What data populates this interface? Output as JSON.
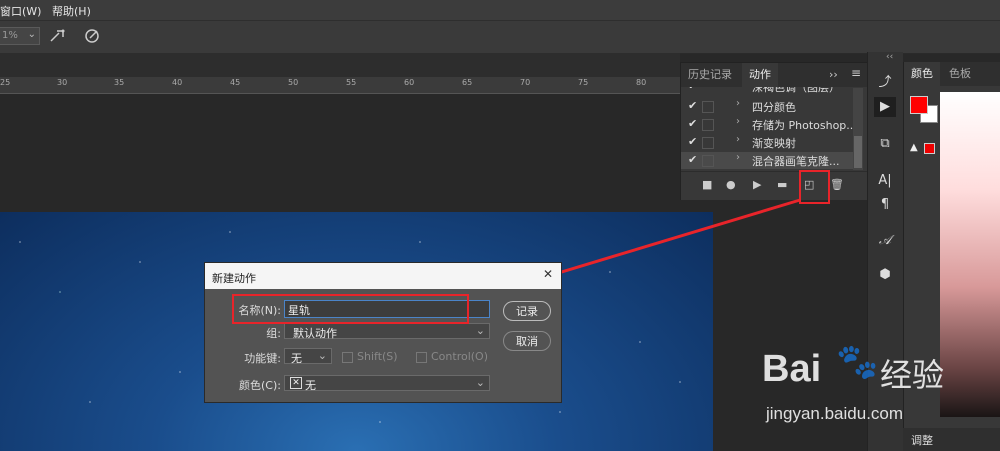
{
  "menu": {
    "window": "窗口(W)",
    "help": "帮助(H)"
  },
  "options": {
    "zoom_value": "1%"
  },
  "ruler": {
    "ticks": [
      "25",
      "30",
      "35",
      "40",
      "45",
      "50",
      "55",
      "60",
      "65",
      "70",
      "75",
      "80"
    ]
  },
  "actions_panel": {
    "tab_history": "历史记录",
    "tab_actions": "动作",
    "menu_glyph": "››",
    "items": [
      {
        "label": "深褐色调（图层）",
        "checked": true
      },
      {
        "label": "四分颜色",
        "checked": true
      },
      {
        "label": "存储为 Photoshop...",
        "checked": true
      },
      {
        "label": "渐变映射",
        "checked": true
      },
      {
        "label": "混合器画笔克隆...",
        "checked": true
      }
    ]
  },
  "color_panel": {
    "tab_color": "颜色",
    "tab_swatches": "色板",
    "fg_color": "#ff0000",
    "bg_color": "#ffffff",
    "adjust_tab": "调整"
  },
  "dialog": {
    "title": "新建动作",
    "name_label": "名称(N):",
    "name_value": "星轨",
    "group_label": "组:",
    "group_value": "默认动作",
    "fkey_label": "功能键:",
    "fkey_value": "无",
    "shift_label": "Shift(S)",
    "control_label": "Control(O)",
    "color_label": "颜色(C):",
    "color_value": "无",
    "record_button": "记录",
    "cancel_button": "取消"
  },
  "watermark": {
    "brand": "Bai",
    "brand2": "经验",
    "url": "jingyan.baidu.com"
  },
  "annotation_color": "#e8242a"
}
